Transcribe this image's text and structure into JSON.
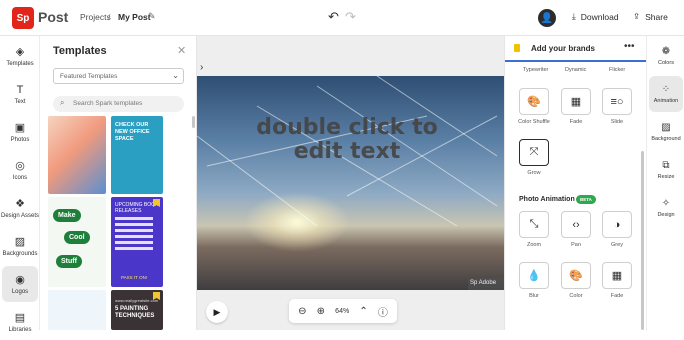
{
  "app": {
    "logo_text": "Sp",
    "name": "Post"
  },
  "breadcrumb": {
    "projects": "Projects",
    "separator": "/",
    "title": "My Post"
  },
  "header": {
    "download": "Download",
    "share": "Share"
  },
  "left_rail": [
    {
      "label": "Templates",
      "icon": "templates-icon"
    },
    {
      "label": "Text",
      "icon": "text-icon"
    },
    {
      "label": "Photos",
      "icon": "photos-icon"
    },
    {
      "label": "Icons",
      "icon": "icons-icon"
    },
    {
      "label": "Design Assets",
      "icon": "design-assets-icon"
    },
    {
      "label": "Backgrounds",
      "icon": "backgrounds-icon"
    },
    {
      "label": "Logos",
      "icon": "logos-icon",
      "active": true
    },
    {
      "label": "Libraries",
      "icon": "libraries-icon"
    }
  ],
  "templates_panel": {
    "title": "Templates",
    "select_value": "Featured Templates",
    "search_placeholder": "Search Spark templates",
    "thumbs": {
      "t2": "CHECK OUR NEW OFFICE SPACE",
      "t3a": "Make",
      "t3b": "Cool",
      "t3c": "Stuff",
      "t4": "UPCOMING BOOK RELEASES",
      "t4_cta": "PASS IT ON!",
      "t6_url": "www.reallygreatsite.com",
      "t6": "5 PAINTING TECHNIQUES"
    }
  },
  "canvas": {
    "text": "double click to edit text",
    "watermark": "Sp Adobe",
    "zoom": "64%"
  },
  "brand_panel": {
    "title": "Add your brands",
    "top_labels": [
      "Typewriter",
      "Dynamic",
      "Flicker"
    ],
    "animations": [
      {
        "label": "Color Shuffle",
        "icon": "color-shuffle-icon"
      },
      {
        "label": "Fade",
        "icon": "fade-icon"
      },
      {
        "label": "Slide",
        "icon": "slide-icon"
      },
      {
        "label": "Grow",
        "icon": "grow-icon",
        "selected": true
      }
    ],
    "photo_section": "Photo Animation",
    "beta": "BETA",
    "photo_animations": [
      {
        "label": "Zoom",
        "icon": "zoom-icon"
      },
      {
        "label": "Pan",
        "icon": "pan-icon"
      },
      {
        "label": "Grey",
        "icon": "grey-icon"
      },
      {
        "label": "Blur",
        "icon": "blur-icon"
      },
      {
        "label": "Color",
        "icon": "color-icon"
      },
      {
        "label": "Fade",
        "icon": "fade-photo-icon"
      }
    ]
  },
  "right_rail": [
    {
      "label": "Colors",
      "icon": "colors-icon"
    },
    {
      "label": "Animation",
      "icon": "animation-icon",
      "active": true
    },
    {
      "label": "Background",
      "icon": "background-icon"
    },
    {
      "label": "Resize",
      "icon": "resize-icon"
    },
    {
      "label": "Design",
      "icon": "design-icon"
    }
  ]
}
